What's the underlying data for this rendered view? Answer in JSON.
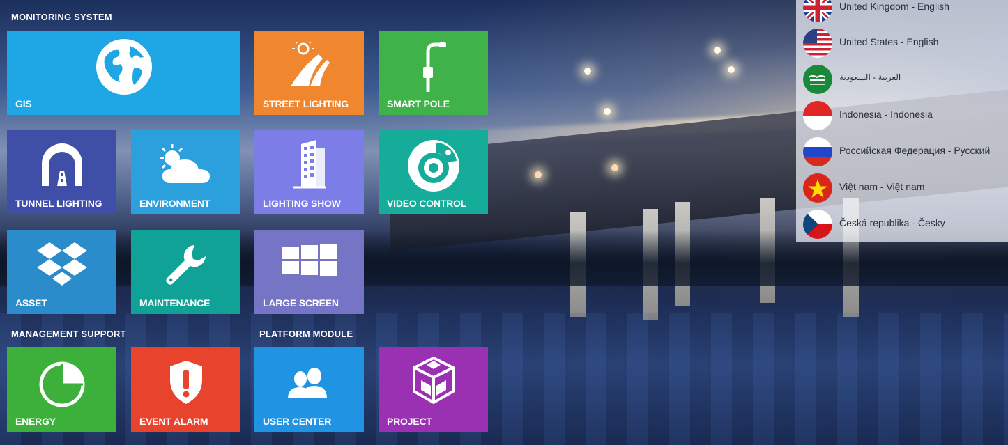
{
  "sections": {
    "monitoring": "MONITORING SYSTEM",
    "management": "MANAGEMENT SUPPORT",
    "platform": "PLATFORM MODULE"
  },
  "tiles": {
    "gis": {
      "label": "GIS",
      "color": "#1ea7e4",
      "icon": "globe-icon"
    },
    "street_lighting": {
      "label": "STREET LIGHTING",
      "color": "#f0862d",
      "icon": "street-light-icon"
    },
    "smart_pole": {
      "label": "SMART POLE",
      "color": "#40b24a",
      "icon": "smart-pole-icon"
    },
    "tunnel_lighting": {
      "label": "TUNNEL LIGHTING",
      "color": "#3f4fa8",
      "icon": "tunnel-icon"
    },
    "environment": {
      "label": "ENVIRONMENT",
      "color": "#2ca0dd",
      "icon": "weather-icon"
    },
    "lighting_show": {
      "label": "LIGHTING SHOW",
      "color": "#7c7de6",
      "icon": "building-icon"
    },
    "video_control": {
      "label": "VIDEO CONTROL",
      "color": "#15ad9a",
      "icon": "camera-icon"
    },
    "asset": {
      "label": "ASSET",
      "color": "#2b8ccc",
      "icon": "dropbox-icon"
    },
    "maintenance": {
      "label": "MAINTENANCE",
      "color": "#11a297",
      "icon": "wrench-icon"
    },
    "large_screen": {
      "label": "LARGE SCREEN",
      "color": "#7674c4",
      "icon": "windows-icon"
    },
    "energy": {
      "label": "ENERGY",
      "color": "#3cb03b",
      "icon": "pie-chart-icon"
    },
    "event_alarm": {
      "label": "EVENT ALARM",
      "color": "#e8432c",
      "icon": "alarm-shield-icon"
    },
    "user_center": {
      "label": "USER CENTER",
      "color": "#2193e3",
      "icon": "users-icon"
    },
    "project": {
      "label": "PROJECT",
      "color": "#9a31b2",
      "icon": "project-cube-icon"
    }
  },
  "languages": [
    {
      "name": "United Kingdom - English",
      "flag": "uk-flag-icon"
    },
    {
      "name": "United States - English",
      "flag": "us-flag-icon"
    },
    {
      "name": "العربية - السعودية",
      "flag": "saudi-flag-icon"
    },
    {
      "name": "Indonesia - Indonesia",
      "flag": "indonesia-flag-icon"
    },
    {
      "name": "Российская Федерация - Русский",
      "flag": "russia-flag-icon"
    },
    {
      "name": "Việt nam - Việt nam",
      "flag": "vietnam-flag-icon"
    },
    {
      "name": "Česká republika - Česky",
      "flag": "czech-flag-icon"
    }
  ]
}
